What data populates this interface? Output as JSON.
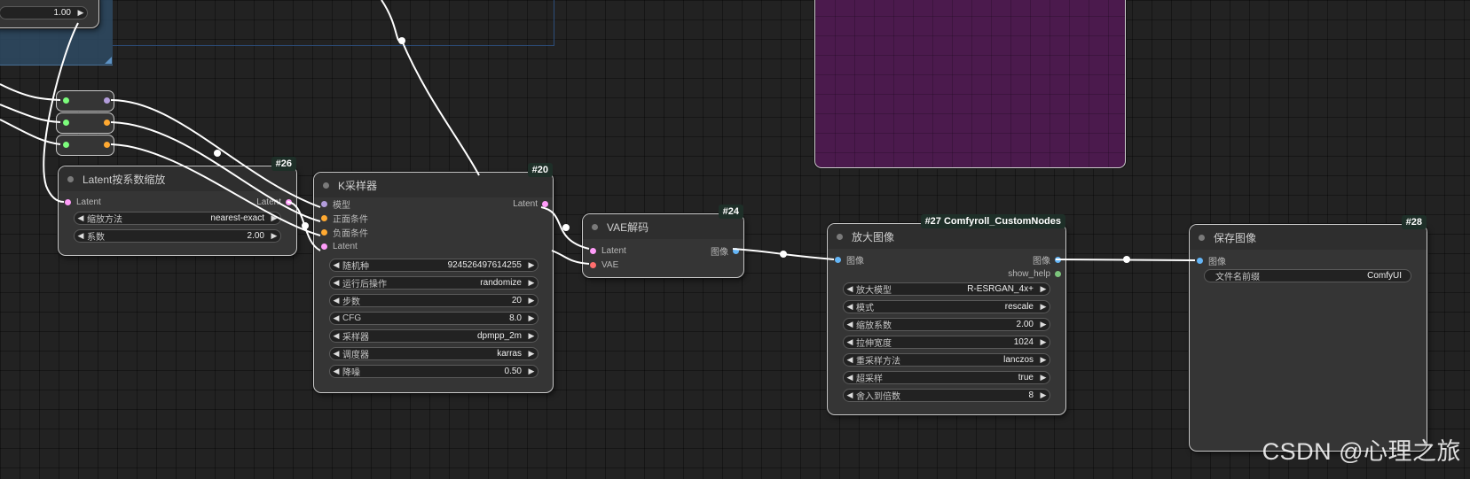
{
  "colors": {
    "latent": "#ff9cf9",
    "conditioning": "#ffa931",
    "model": "#b39ddb",
    "vae": "#ff6e6e",
    "image": "#64b5f6",
    "generic": "#7cfc7c",
    "group_purple": "#4b1a4d"
  },
  "top_widget": {
    "value": "1.00"
  },
  "reroutes": [
    {
      "in_color": "generic",
      "out_color": "model"
    },
    {
      "in_color": "generic",
      "out_color": "conditioning"
    },
    {
      "in_color": "generic",
      "out_color": "conditioning"
    }
  ],
  "latent_scale": {
    "id": "#26",
    "title": "Latent按系数缩放",
    "input": "Latent",
    "output": "Latent",
    "widgets": [
      {
        "label": "缩放方法",
        "value": "nearest-exact"
      },
      {
        "label": "系数",
        "value": "2.00"
      }
    ]
  },
  "ksampler": {
    "id": "#20",
    "title": "K采样器",
    "inputs": [
      "模型",
      "正面条件",
      "负面条件",
      "Latent"
    ],
    "output": "Latent",
    "widgets": [
      {
        "label": "随机种",
        "value": "924526497614255"
      },
      {
        "label": "运行后操作",
        "value": "randomize"
      },
      {
        "label": "步数",
        "value": "20"
      },
      {
        "label": "CFG",
        "value": "8.0"
      },
      {
        "label": "采样器",
        "value": "dpmpp_2m"
      },
      {
        "label": "调度器",
        "value": "karras"
      },
      {
        "label": "降噪",
        "value": "0.50"
      }
    ]
  },
  "vae_decode": {
    "id": "#24",
    "title": "VAE解码",
    "inputs": [
      "Latent",
      "VAE"
    ],
    "output": "图像"
  },
  "upscale": {
    "id": "#27 Comfyroll_CustomNodes",
    "title": "放大图像",
    "input": "图像",
    "outputs": [
      "图像",
      "show_help"
    ],
    "widgets": [
      {
        "label": "放大模型",
        "value": "R-ESRGAN_4x+"
      },
      {
        "label": "模式",
        "value": "rescale"
      },
      {
        "label": "缩放系数",
        "value": "2.00"
      },
      {
        "label": "拉伸宽度",
        "value": "1024"
      },
      {
        "label": "重采样方法",
        "value": "lanczos"
      },
      {
        "label": "超采样",
        "value": "true"
      },
      {
        "label": "舍入到倍数",
        "value": "8"
      }
    ]
  },
  "save_image": {
    "id": "#28",
    "title": "保存图像",
    "input": "图像",
    "widgets": [
      {
        "label": "文件名前缀",
        "value": "ComfyUI"
      }
    ]
  },
  "watermark": "CSDN @心理之旅"
}
